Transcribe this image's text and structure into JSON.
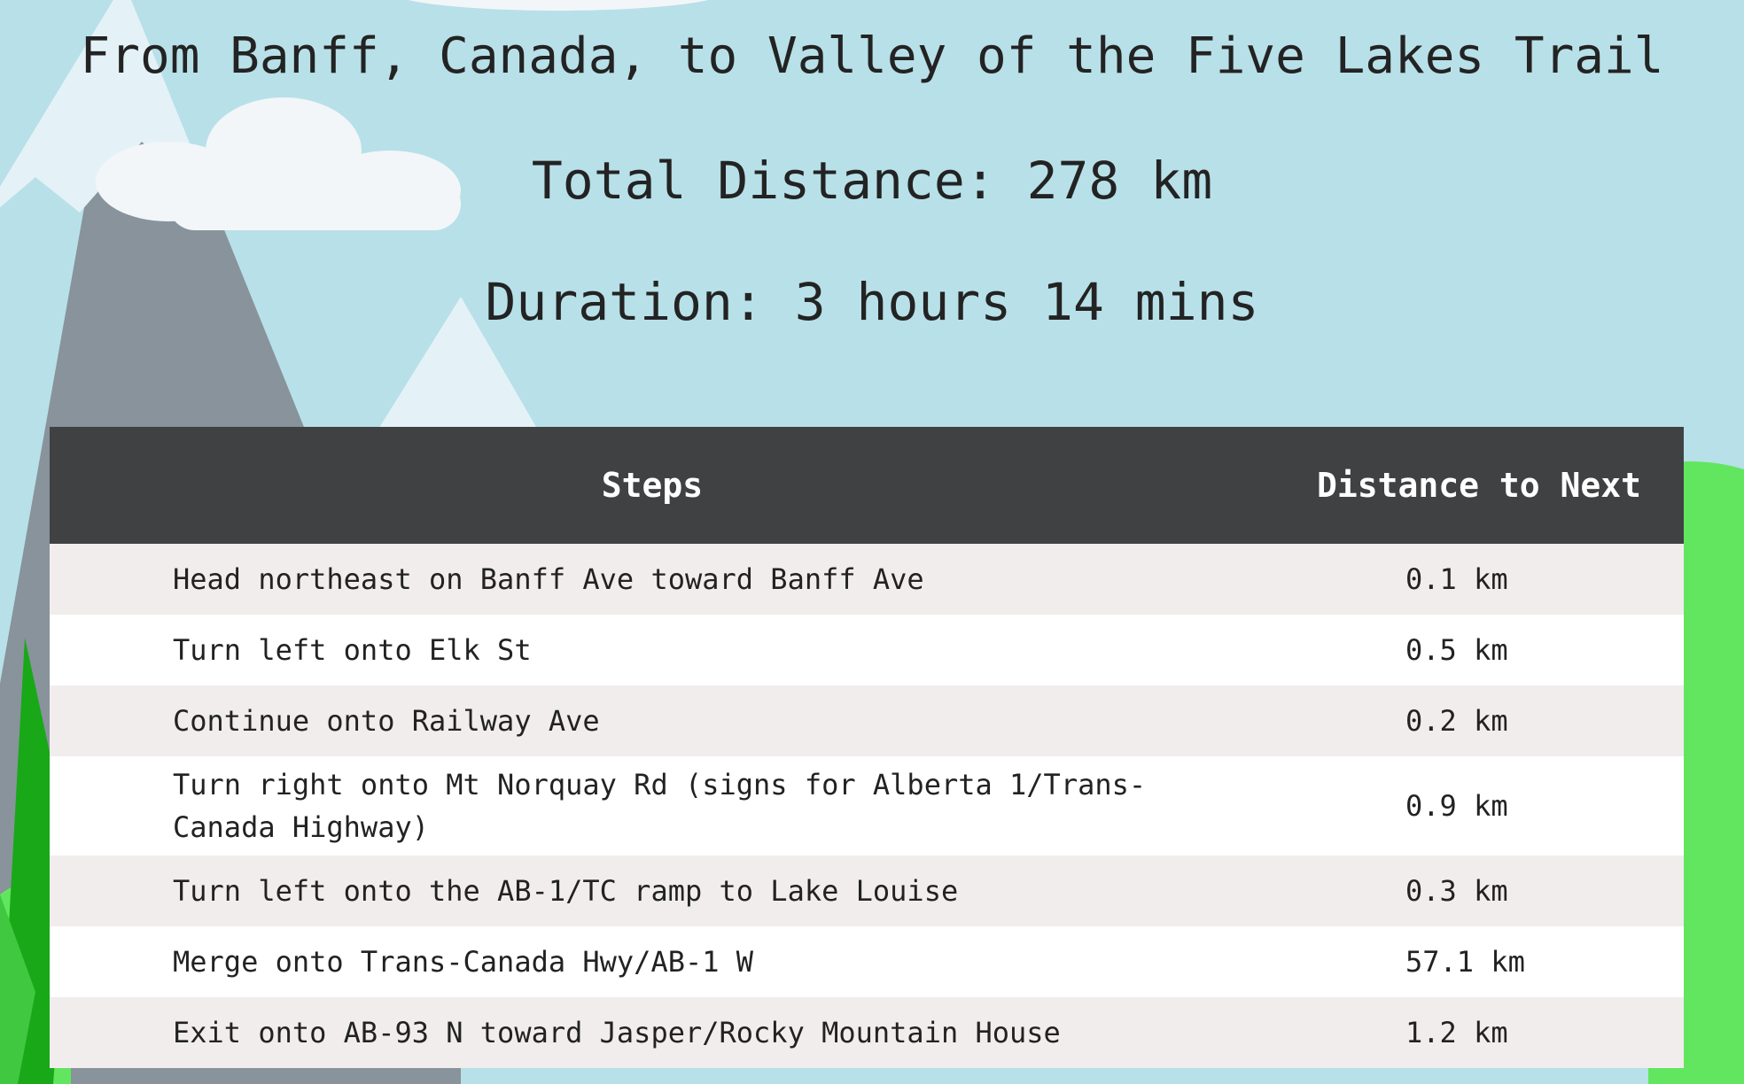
{
  "header": {
    "title": "From Banff, Canada, to Valley of the Five Lakes Trail",
    "total_distance": "Total Distance: 278 km",
    "duration": "Duration: 3 hours 14 mins"
  },
  "table": {
    "headers": {
      "steps": "Steps",
      "distance": "Distance to Next"
    },
    "rows": [
      {
        "step": "Head northeast on Banff Ave toward Banff Ave",
        "distance": "0.1 km"
      },
      {
        "step": "Turn left onto Elk St",
        "distance": "0.5 km"
      },
      {
        "step": "Continue onto Railway Ave",
        "distance": "0.2 km"
      },
      {
        "step": "Turn right onto Mt Norquay Rd (signs for Alberta 1/Trans-Canada Highway)",
        "distance": "0.9 km"
      },
      {
        "step": "Turn left onto the AB-1/TC ramp to Lake Louise",
        "distance": "0.3 km"
      },
      {
        "step": "Merge onto Trans-Canada Hwy/AB-1 W",
        "distance": "57.1 km"
      },
      {
        "step": "Exit onto AB-93 N toward Jasper/Rocky Mountain House",
        "distance": "1.2 km"
      }
    ]
  },
  "colors": {
    "sky": "#b8e0e8",
    "mountain": "#8a949c",
    "snow": "#e4f2f8",
    "cloud": "#f2f6f8",
    "grass": "#62e660",
    "tree_dark": "#18a818",
    "table_header": "#404143",
    "row_alt": "#f2eded"
  }
}
